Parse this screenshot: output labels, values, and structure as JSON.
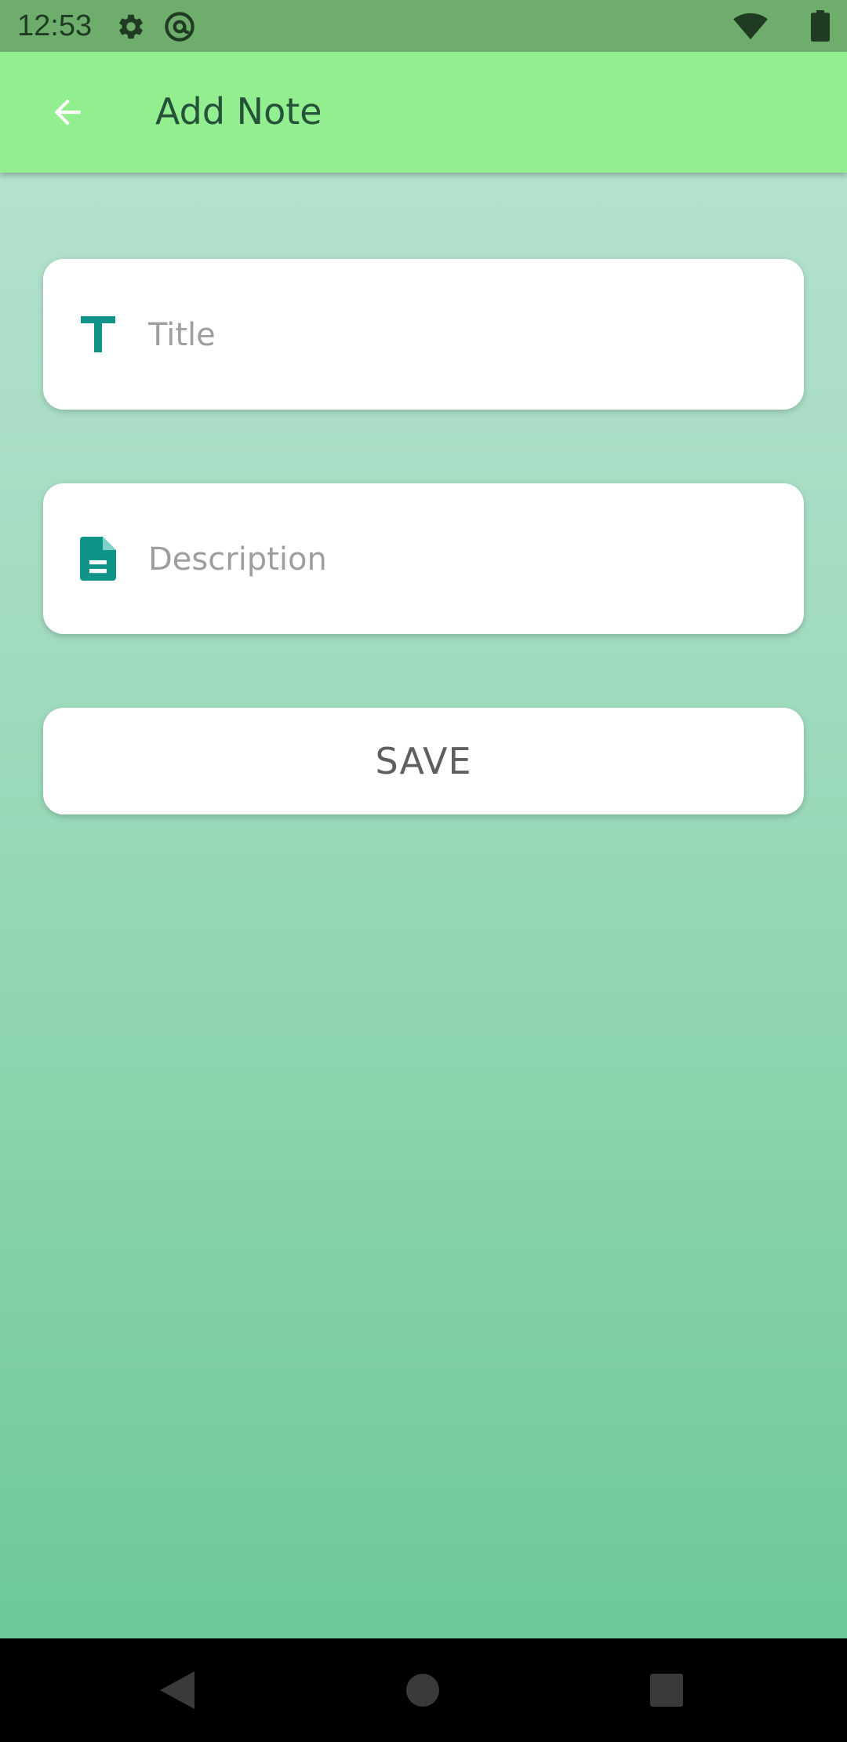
{
  "status_bar": {
    "time": "12:53",
    "icons": [
      "gear-icon",
      "at-sign-icon",
      "wifi-icon",
      "battery-icon"
    ]
  },
  "app_bar": {
    "title": "Add Note",
    "back_icon": "arrow-left-icon"
  },
  "form": {
    "title_field": {
      "placeholder": "Title",
      "value": "",
      "icon": "text-t-icon"
    },
    "description_field": {
      "placeholder": "Description",
      "value": "",
      "icon": "document-icon"
    },
    "save_label": "SAVE"
  },
  "nav_bar": {
    "buttons": [
      "back-triangle-icon",
      "home-circle-icon",
      "recents-square-icon"
    ]
  },
  "colors": {
    "status_bar": "#6ead6c",
    "app_bar": "#92ee8e",
    "accent_icon": "#119488",
    "title_text": "#24533a",
    "background_top": "#b9e3d1",
    "background_bottom": "#66c695"
  }
}
